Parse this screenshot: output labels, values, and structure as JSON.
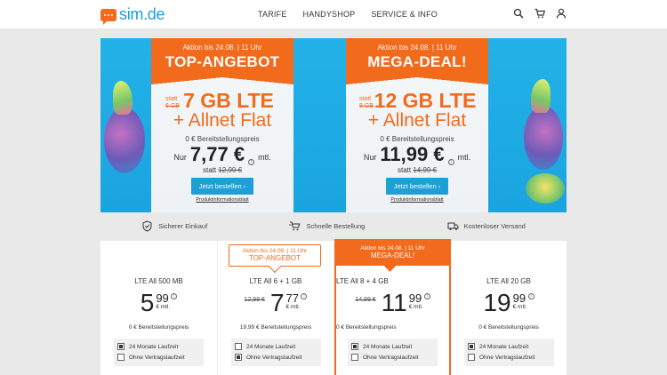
{
  "brand": {
    "logo_text": "sim.de",
    "accent": "#f26a1b",
    "blue": "#1d9fd8"
  },
  "nav": {
    "items": [
      "TARIFE",
      "HANDYSHOP",
      "SERVICE & INFO"
    ]
  },
  "header_icons": [
    "search-icon",
    "cart-icon",
    "user-icon"
  ],
  "hero": {
    "offers": [
      {
        "action": "Aktion bis 24.08. | 11 Uhr",
        "title": "TOP-ANGEBOT",
        "statt_label": "statt",
        "old_gb": "6 GB",
        "gb": "7 GB LTE",
        "allnet": "+ Allnet Flat",
        "bereitstellung": "0 € Bereitstellungspreis",
        "nur": "Nur",
        "price": "7,77 €",
        "mtl": "mtl.",
        "statt_price_label": "statt",
        "old_price": "12,99 €",
        "button": "Jetzt bestellen ›",
        "pib": "Produktinformationsblatt"
      },
      {
        "action": "Aktion bis 24.08. | 11 Uhr",
        "title": "MEGA-DEAL!",
        "statt_label": "statt",
        "old_gb": "8 GB",
        "gb": "12 GB LTE",
        "allnet": "+ Allnet Flat",
        "bereitstellung": "0 € Bereitstellungspreis",
        "nur": "Nur",
        "price": "11,99 €",
        "mtl": "mtl.",
        "statt_price_label": "statt",
        "old_price": "14,99 €",
        "button": "Jetzt bestellen ›",
        "pib": "Produktinformationsblatt"
      }
    ]
  },
  "trust": {
    "items": [
      "Sicherer Einkauf",
      "Schnelle Bestellung",
      "Kostenloser Versand"
    ]
  },
  "tariffs": [
    {
      "name": "LTE All 500 MB",
      "old_price": "",
      "euro": "5",
      "cents": "99",
      "unit": "€ mtl.",
      "bereit": "0 € Bereitstellungspreis",
      "opt1": "24 Monate Laufzeit",
      "opt2": "Ohne Vertragslaufzeit",
      "opt1_checked": true,
      "opt2_checked": false
    },
    {
      "name": "LTE All 6 + 1 GB",
      "old_price": "12,99 €",
      "euro": "7",
      "cents": "77",
      "unit": "€ mtl.",
      "bereit": "19,99 € Bereitstellungspreis",
      "opt1": "24 Monate Laufzeit",
      "opt2": "Ohne Vertragslaufzeit",
      "opt1_checked": false,
      "opt2_checked": true
    },
    {
      "name": "LTE All 8 + 4 GB",
      "old_price": "14,99 €",
      "euro": "11",
      "cents": "99",
      "unit": "€ mtl.",
      "bereit": "0 € Bereitstellungspreis",
      "opt1": "24 Monate Laufzeit",
      "opt2": "Ohne Vertragslaufzeit",
      "opt1_checked": true,
      "opt2_checked": false
    },
    {
      "name": "LTE All 20 GB",
      "old_price": "",
      "euro": "19",
      "cents": "99",
      "unit": "€ mtl.",
      "bereit": "0 € Bereitstellungspreis",
      "opt1": "24 Monate Laufzeit",
      "opt2": "Ohne Vertragslaufzeit",
      "opt1_checked": true,
      "opt2_checked": false
    }
  ],
  "ribbons": {
    "top": {
      "r1": "Aktion bis 24.08. | 11 Uhr",
      "r2": "TOP-ANGEBOT"
    },
    "mega": {
      "r1": "Aktion bis 24.08. | 11 Uhr",
      "r2": "MEGA-DEAL!"
    }
  }
}
